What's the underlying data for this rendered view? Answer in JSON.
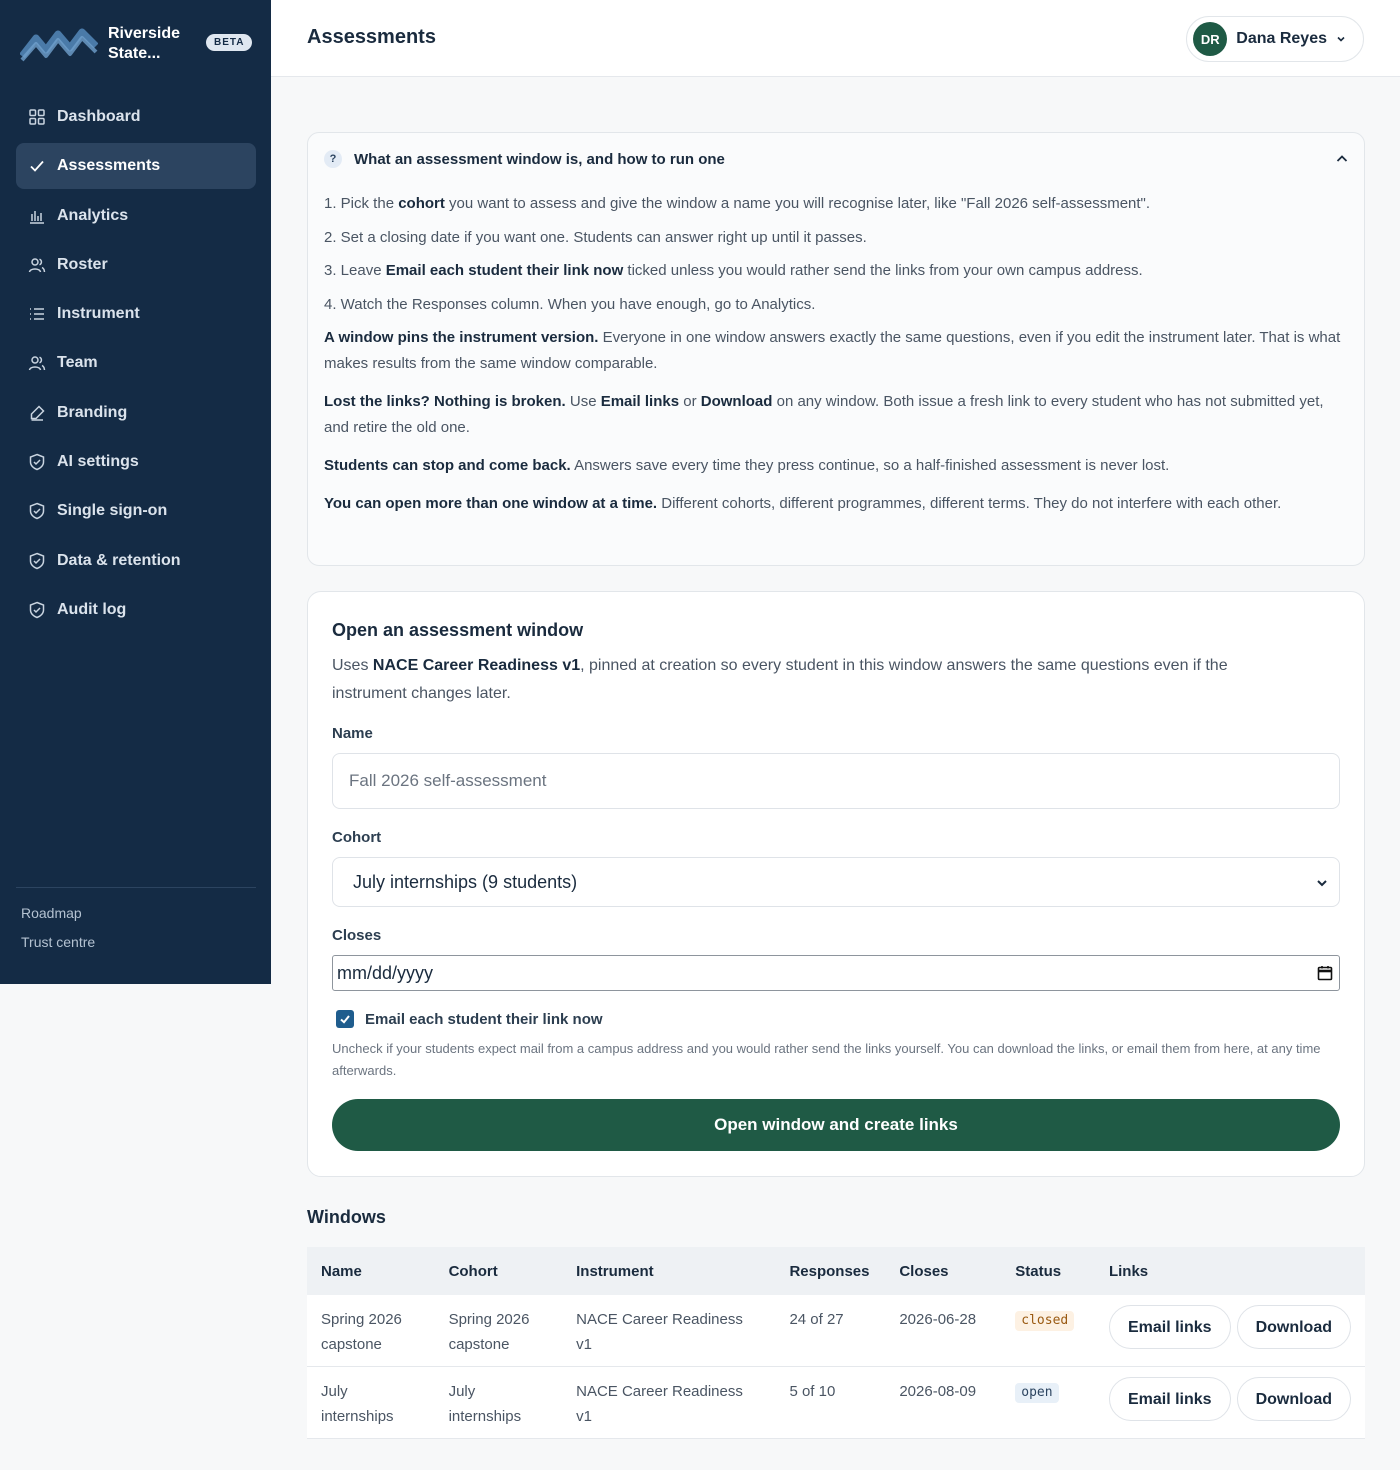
{
  "sidebar": {
    "brand_name": "Riverside State...",
    "beta_badge": "BETA",
    "items": [
      {
        "label": "Dashboard",
        "icon": "grid-icon"
      },
      {
        "label": "Assessments",
        "icon": "check-icon",
        "active": true
      },
      {
        "label": "Analytics",
        "icon": "bar-chart-icon"
      },
      {
        "label": "Roster",
        "icon": "users-icon"
      },
      {
        "label": "Instrument",
        "icon": "list-icon"
      },
      {
        "label": "Team",
        "icon": "users-icon"
      },
      {
        "label": "Branding",
        "icon": "paint-icon"
      },
      {
        "label": "AI settings",
        "icon": "shield-icon"
      },
      {
        "label": "Single sign-on",
        "icon": "shield-icon"
      },
      {
        "label": "Data & retention",
        "icon": "shield-icon"
      },
      {
        "label": "Audit log",
        "icon": "shield-icon"
      }
    ],
    "footer_links": [
      "Roadmap",
      "Trust centre"
    ]
  },
  "header": {
    "title": "Assessments",
    "user_initials": "DR",
    "user_name": "Dana Reyes"
  },
  "help": {
    "title": "What an assessment window is, and how to run one",
    "steps": [
      {
        "pre": "1. Pick the ",
        "bold": "cohort",
        "post": " you want to assess and give the window a name you will recognise later, like \"Fall 2026 self-assessment\"."
      },
      {
        "pre": "2. Set a closing date if you want one. Students can answer right up until it passes.",
        "bold": "",
        "post": ""
      },
      {
        "pre": "3. Leave ",
        "bold": "Email each student their link now",
        "post": " ticked unless you would rather send the links from your own campus address."
      },
      {
        "pre": "4. Watch the Responses column. When you have enough, go to Analytics.",
        "bold": "",
        "post": ""
      }
    ],
    "p1_bold": "A window pins the instrument version.",
    "p1_text": " Everyone in one window answers exactly the same questions, even if you edit the instrument later. That is what makes results from the same window comparable.",
    "p2_bold": "Lost the links? Nothing is broken.",
    "p2_text_a": " Use ",
    "p2_bold_b": "Email links",
    "p2_text_c": " or ",
    "p2_bold_d": "Download",
    "p2_text_e": " on any window. Both issue a fresh link to every student who has not submitted yet, and retire the old one.",
    "p3_bold": "Students can stop and come back.",
    "p3_text": " Answers save every time they press continue, so a half-finished assessment is never lost.",
    "p4_bold": "You can open more than one window at a time.",
    "p4_text": " Different cohorts, different programmes, different terms. They do not interfere with each other."
  },
  "form": {
    "title": "Open an assessment window",
    "desc_pre": "Uses ",
    "desc_bold": "NACE Career Readiness v1",
    "desc_post": ", pinned at creation so every student in this window answers the same questions even if the instrument changes later.",
    "name_label": "Name",
    "name_placeholder": "Fall 2026 self-assessment",
    "cohort_label": "Cohort",
    "cohort_value": "July internships (9 students)",
    "closes_label": "Closes",
    "closes_placeholder": "mm/dd/yyyy",
    "email_checkbox_label": "Email each student their link now",
    "email_checked": true,
    "hint": "Uncheck if your students expect mail from a campus address and you would rather send the links yourself. You can download the links, or email them from here, at any time afterwards.",
    "submit_label": "Open window and create links"
  },
  "windows": {
    "title": "Windows",
    "columns": [
      "Name",
      "Cohort",
      "Instrument",
      "Responses",
      "Closes",
      "Status",
      "Links"
    ],
    "rows": [
      {
        "name": "Spring 2026 capstone",
        "cohort": "Spring 2026 capstone",
        "instrument": "NACE Career Readiness v1",
        "responses": "24 of 27",
        "closes": "2026-06-28",
        "status": "closed",
        "email_label": "Email links",
        "download_label": "Download"
      },
      {
        "name": "July internships",
        "cohort": "July internships",
        "instrument": "NACE Career Readiness v1",
        "responses": "5 of 10",
        "closes": "2026-08-09",
        "status": "open",
        "email_label": "Email links",
        "download_label": "Download"
      }
    ]
  },
  "colors": {
    "sidebar_bg": "#142b45",
    "primary_green": "#1f5a45",
    "checkbox_blue": "#1f5d8e"
  }
}
